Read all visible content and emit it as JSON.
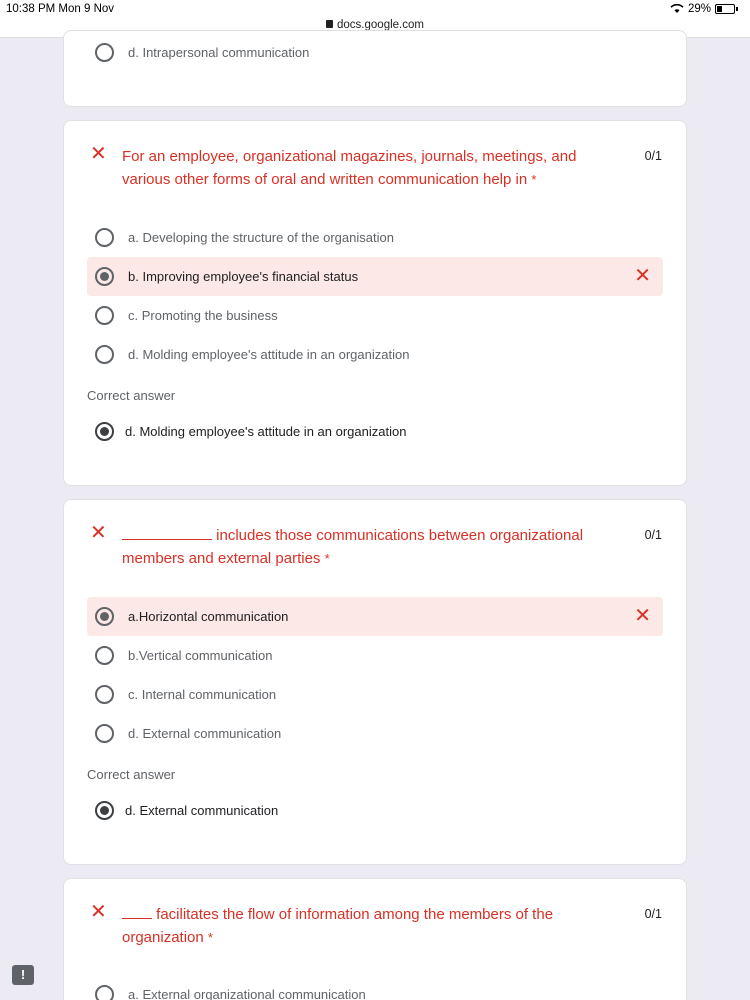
{
  "status_bar": {
    "time": "10:38 PM  Mon 9 Nov",
    "battery": "29%",
    "url": "docs.google.com"
  },
  "top_card": {
    "option_d": "d. Intrapersonal communication"
  },
  "q1": {
    "mark": "✕",
    "text": "For an employee, organizational magazines, journals, meetings, and various other forms of oral and written communication help in",
    "required": "*",
    "score": "0/1",
    "options": [
      "a. Developing the structure of the organisation",
      "b. Improving employee's financial status",
      "c. Promoting the business",
      "d. Molding employee's attitude in an organization"
    ],
    "selected_index": 1,
    "correct_label": "Correct answer",
    "correct_answer": "d. Molding employee's attitude in an organization"
  },
  "q2": {
    "mark": "✕",
    "text": "includes those communications between organizational members and external parties",
    "required": "*",
    "score": "0/1",
    "options": [
      "a.Horizontal communication",
      "b.Vertical communication",
      "c. Internal communication",
      "d. External communication"
    ],
    "selected_index": 0,
    "correct_label": "Correct answer",
    "correct_answer": "d. External communication"
  },
  "q3": {
    "mark": "✕",
    "text": "facilitates the flow of information among the members of the organization",
    "required": "*",
    "score": "0/1",
    "options": [
      "a. External organizational communication"
    ]
  },
  "colors": {
    "error": "#d93025",
    "wrong_bg": "#fce8e6",
    "page_bg": "#ecebf4"
  },
  "icons": [
    "wifi-icon",
    "battery-icon",
    "lock-icon",
    "close-icon",
    "radio-icon",
    "feedback-icon"
  ]
}
